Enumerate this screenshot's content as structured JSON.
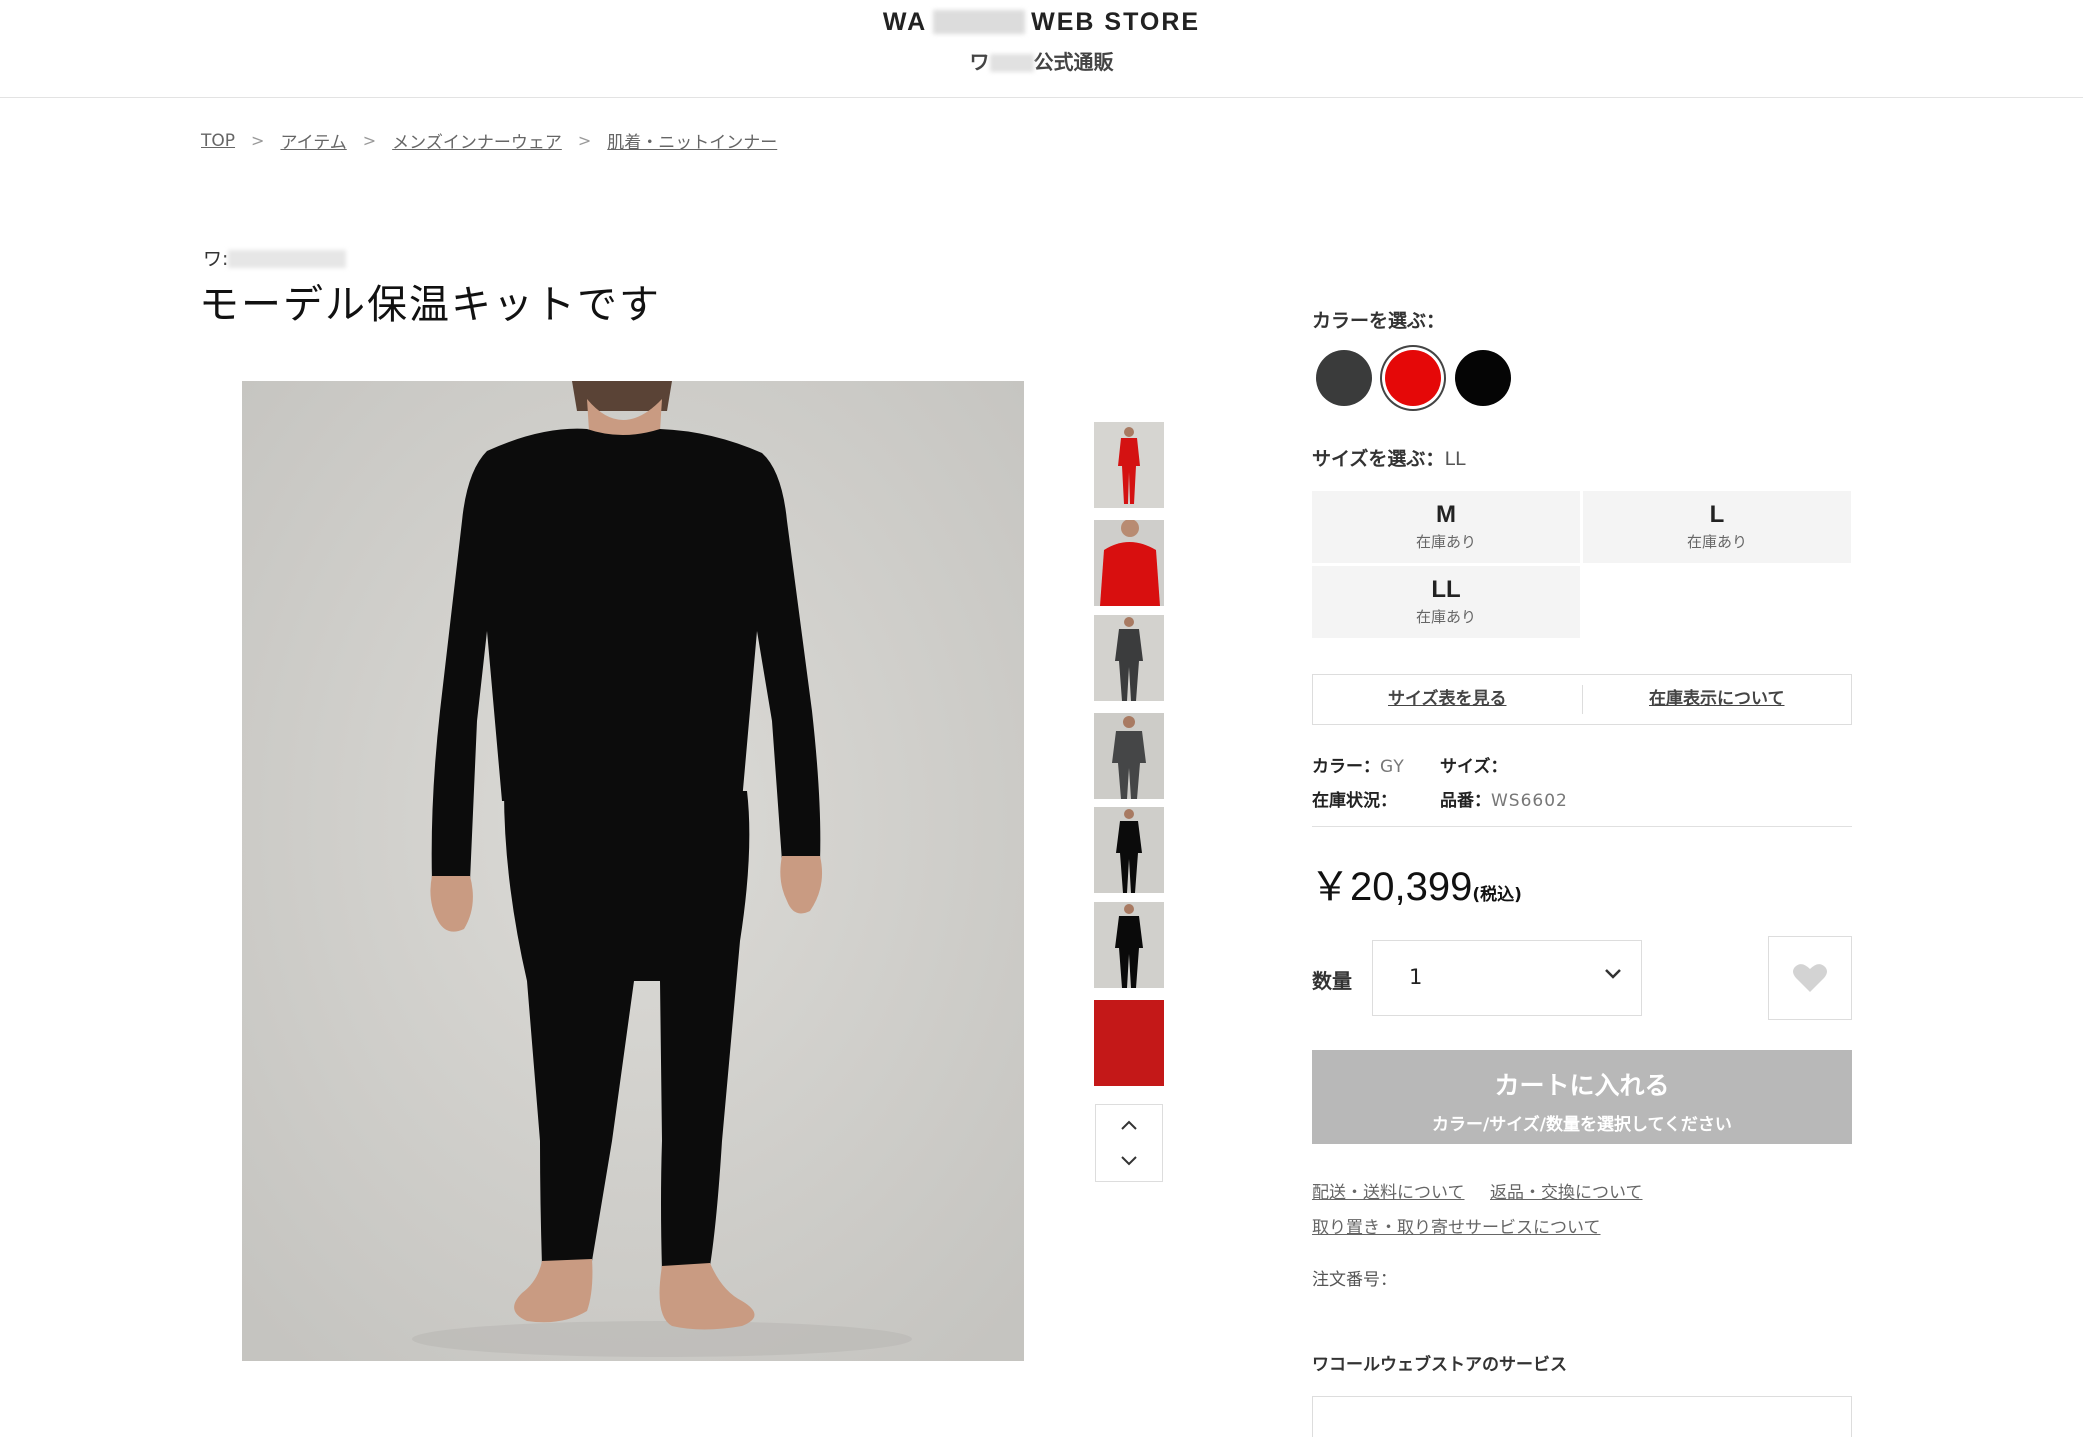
{
  "header": {
    "logo_left": "WA",
    "logo_right": "WEB STORE",
    "sub_left": "ワ",
    "sub_right": "公式通販"
  },
  "breadcrumb": [
    "TOP",
    "アイテム",
    "メンズインナーウェア",
    "肌着・ニットインナー"
  ],
  "breadcrumb_sep": ">",
  "product": {
    "brand": "ワ:",
    "title": "モーデル保温キットです"
  },
  "colors": {
    "label": "カラーを選ぶ：",
    "swatches": [
      {
        "name": "charcoal",
        "hex": "#3a3b3b"
      },
      {
        "name": "red",
        "hex": "#e50808",
        "selected": true
      },
      {
        "name": "black",
        "hex": "#050505"
      }
    ]
  },
  "sizes": {
    "label": "サイズを選ぶ：",
    "selected": "LL",
    "options": [
      {
        "size": "M",
        "stock": "在庫あり"
      },
      {
        "size": "L",
        "stock": "在庫あり"
      },
      {
        "size": "LL",
        "stock": "在庫あり"
      }
    ]
  },
  "info_links": {
    "size_chart": "サイズ表を見る",
    "stock_info": "在庫表示について"
  },
  "meta": {
    "color_label": "カラー：",
    "color_value": "GY",
    "size_label": "サイズ：",
    "size_value": "",
    "stock_label": "在庫状況：",
    "stock_value": "",
    "sku_label": "品番：",
    "sku_value": "WS6602"
  },
  "price": {
    "amount": "￥20,399",
    "tax": "(税込)"
  },
  "quantity": {
    "label": "数量",
    "value": "1"
  },
  "cart": {
    "title": "カートに入れる",
    "subtitle": "カラー/サイズ/数量を選択してください"
  },
  "footer_links": {
    "shipping": "配送・送料について",
    "returns": "返品・交換について",
    "reserve": "取り置き・取り寄せサービスについて"
  },
  "order_no": "注文番号：",
  "service_heading": "ワコールウェブストアのサービス",
  "ui_colors": {
    "cart_disabled": "#b8b8b8",
    "border": "#dddddd"
  }
}
